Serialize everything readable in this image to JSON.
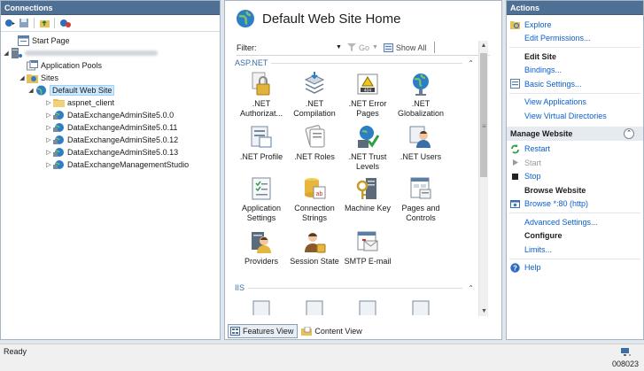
{
  "connections": {
    "title": "Connections",
    "tree": [
      {
        "label": "Start Page",
        "icon": "start-page-icon",
        "toggle": ""
      },
      {
        "label": "",
        "icon": "server-icon",
        "toggle": "◢",
        "blurred": true
      },
      {
        "label": "Application Pools",
        "icon": "app-pools-icon",
        "toggle": ""
      },
      {
        "label": "Sites",
        "icon": "sites-folder-icon",
        "toggle": "◢"
      },
      {
        "label": "Default Web Site",
        "icon": "globe-icon",
        "toggle": "◢",
        "selected": true
      },
      {
        "label": "aspnet_client",
        "icon": "folder-icon",
        "toggle": "▷"
      },
      {
        "label": "DataExchangeAdminSite5.0.0",
        "icon": "web-app-icon",
        "toggle": "▷"
      },
      {
        "label": "DataExchangeAdminSite5.0.11",
        "icon": "web-app-icon",
        "toggle": "▷"
      },
      {
        "label": "DataExchangeAdminSite5.0.12",
        "icon": "web-app-icon",
        "toggle": "▷"
      },
      {
        "label": "DataExchangeAdminSite5.0.13",
        "icon": "web-app-icon",
        "toggle": "▷"
      },
      {
        "label": "DataExchangeManagementStudio",
        "icon": "web-app-icon",
        "toggle": "▷"
      }
    ]
  },
  "center": {
    "title": "Default Web Site Home",
    "filter": {
      "label": "Filter:",
      "value": "",
      "go_label": "Go",
      "show_all_label": "Show All"
    },
    "groups": [
      {
        "name": "ASP.NET",
        "features": [
          {
            "label": ".NET Authorizat...",
            "icon": "lock-icon"
          },
          {
            "label": ".NET Compilation",
            "icon": "compilation-icon"
          },
          {
            "label": ".NET Error Pages",
            "icon": "error-page-icon"
          },
          {
            "label": ".NET Globalization",
            "icon": "globalization-icon"
          },
          {
            "label": ".NET Profile",
            "icon": "profile-icon"
          },
          {
            "label": ".NET Roles",
            "icon": "roles-icon"
          },
          {
            "label": ".NET Trust Levels",
            "icon": "trust-levels-icon"
          },
          {
            "label": ".NET Users",
            "icon": "users-icon"
          },
          {
            "label": "Application Settings",
            "icon": "app-settings-icon"
          },
          {
            "label": "Connection Strings",
            "icon": "database-icon"
          },
          {
            "label": "Machine Key",
            "icon": "machine-key-icon"
          },
          {
            "label": "Pages and Controls",
            "icon": "pages-controls-icon"
          },
          {
            "label": "Providers",
            "icon": "providers-icon"
          },
          {
            "label": "Session State",
            "icon": "session-state-icon"
          },
          {
            "label": "SMTP E-mail",
            "icon": "smtp-icon"
          }
        ]
      },
      {
        "name": "IIS",
        "features": []
      }
    ],
    "tabs": [
      {
        "label": "Features View",
        "active": true
      },
      {
        "label": "Content View",
        "active": false
      }
    ]
  },
  "actions": {
    "title": "Actions",
    "items": [
      {
        "type": "link",
        "label": "Explore",
        "icon": "explore-icon"
      },
      {
        "type": "link",
        "label": "Edit Permissions..."
      },
      {
        "type": "sep"
      },
      {
        "type": "head",
        "label": "Edit Site"
      },
      {
        "type": "link",
        "label": "Bindings..."
      },
      {
        "type": "link",
        "label": "Basic Settings...",
        "icon": "basic-settings-icon"
      },
      {
        "type": "sep"
      },
      {
        "type": "link",
        "label": "View Applications"
      },
      {
        "type": "link",
        "label": "View Virtual Directories"
      },
      {
        "type": "section",
        "label": "Manage Website"
      },
      {
        "type": "link",
        "label": "Restart",
        "icon": "restart-icon"
      },
      {
        "type": "disabled",
        "label": "Start",
        "icon": "start-icon"
      },
      {
        "type": "link",
        "label": "Stop",
        "icon": "stop-icon"
      },
      {
        "type": "head",
        "label": "Browse Website"
      },
      {
        "type": "link",
        "label": "Browse *:80 (http)",
        "icon": "browse-icon"
      },
      {
        "type": "sep"
      },
      {
        "type": "link",
        "label": "Advanced Settings..."
      },
      {
        "type": "head",
        "label": "Configure"
      },
      {
        "type": "link",
        "label": "Limits..."
      },
      {
        "type": "sep"
      },
      {
        "type": "link",
        "label": "Help",
        "icon": "help-icon"
      }
    ]
  },
  "status": {
    "text": "Ready",
    "figure_id": "008023"
  },
  "colors": {
    "pane_header": "#4f7095",
    "link": "#0a5ecc",
    "selection": "#cce8ff",
    "frame": "#dfe6ee"
  }
}
